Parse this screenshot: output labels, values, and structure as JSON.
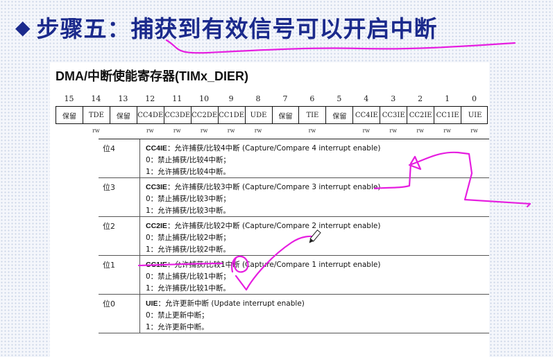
{
  "slide": {
    "title": "步骤五：捕获到有效信号可以开启中断",
    "bullet_icon": "diamond-icon"
  },
  "doc": {
    "title": "DMA/中断使能寄存器(TIMx_DIER)",
    "bit_numbers": [
      "15",
      "14",
      "13",
      "12",
      "11",
      "10",
      "9",
      "8",
      "7",
      "6",
      "5",
      "4",
      "3",
      "2",
      "1",
      "0"
    ],
    "fields": [
      {
        "label": "保留",
        "span": 1
      },
      {
        "label": "TDE",
        "span": 1
      },
      {
        "label": "保留",
        "span": 1
      },
      {
        "label": "CC4DE",
        "span": 1
      },
      {
        "label": "CC3DE",
        "span": 1
      },
      {
        "label": "CC2DE",
        "span": 1
      },
      {
        "label": "CC1DE",
        "span": 1
      },
      {
        "label": "UDE",
        "span": 1
      },
      {
        "label": "保留",
        "span": 1
      },
      {
        "label": "TIE",
        "span": 1
      },
      {
        "label": "保留",
        "span": 1
      },
      {
        "label": "CC4IE",
        "span": 1
      },
      {
        "label": "CC3IE",
        "span": 1
      },
      {
        "label": "CC2IE",
        "span": 1
      },
      {
        "label": "CC1IE",
        "span": 1
      },
      {
        "label": "UIE",
        "span": 1
      }
    ],
    "rw": [
      "",
      "rw",
      "",
      "rw",
      "rw",
      "rw",
      "rw",
      "rw",
      "",
      "rw",
      "",
      "rw",
      "rw",
      "rw",
      "rw",
      "rw"
    ],
    "descriptions": [
      {
        "bit": "位4",
        "name": "CC4IE",
        "desc": "：允许捕获/比较4中断 (Capture/Compare 4 interrupt enable)",
        "line0": "0：禁止捕获/比较4中断；",
        "line1": "1：允许捕获/比较4中断。"
      },
      {
        "bit": "位3",
        "name": "CC3IE",
        "desc": "：允许捕获/比较3中断 (Capture/Compare 3 interrupt enable)",
        "line0": "0：禁止捕获/比较3中断；",
        "line1": "1：允许捕获/比较3中断。"
      },
      {
        "bit": "位2",
        "name": "CC2IE",
        "desc": "：允许捕获/比较2中断 (Capture/Compare 2 interrupt enable)",
        "line0": "0：禁止捕获/比较2中断；",
        "line1": "1：允许捕获/比较2中断。"
      },
      {
        "bit": "位1",
        "name": "CC1IE",
        "desc": "：允许捕获/比较1中断 (Capture/Compare 1 interrupt enable)",
        "line0": "0：禁止捕获/比较1中断；",
        "line1": "1：允许捕获/比较1中断。"
      },
      {
        "bit": "位0",
        "name": "UIE",
        "desc": "：允许更新中断 (Update interrupt enable)",
        "line0": "0：禁止更新中断；",
        "line1": "1：允许更新中断。"
      }
    ]
  },
  "annotations": {
    "ink_color": "#e61ee0",
    "pen_cursor_icon": "pen-cursor-icon"
  }
}
